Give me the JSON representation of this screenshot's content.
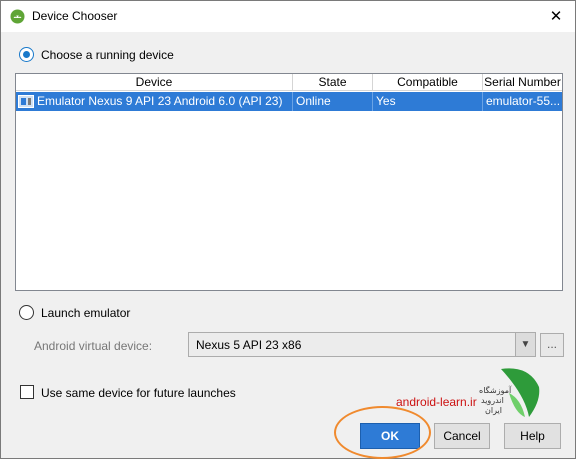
{
  "window": {
    "title": "Device Chooser"
  },
  "running": {
    "radio_label": "Choose a running device",
    "checked": true,
    "columns": [
      "Device",
      "State",
      "Compatible",
      "Serial Number"
    ],
    "rows": [
      {
        "device": "Emulator Nexus 9 API 23 Android 6.0 (API 23)",
        "state": "Online",
        "compatible": "Yes",
        "serial": "emulator-55..."
      }
    ]
  },
  "launch": {
    "radio_label": "Launch emulator",
    "checked": false,
    "avd_label": "Android virtual device:",
    "avd_value": "Nexus 5 API 23 x86",
    "browse_label": "..."
  },
  "same_device": {
    "label": "Use same device for future launches",
    "checked": false
  },
  "watermark": {
    "text": "android-learn.ir"
  },
  "buttons": {
    "ok": "OK",
    "cancel": "Cancel",
    "help": "Help"
  },
  "colors": {
    "selection": "#2e7bd6",
    "radio_accent": "#1979ca",
    "highlight_ring": "#f08a2e",
    "watermark": "#cc1111"
  },
  "icons": {
    "app": "android-studio-icon",
    "close": "close-icon",
    "device": "device-icon",
    "dropdown": "chevron-down-icon"
  }
}
